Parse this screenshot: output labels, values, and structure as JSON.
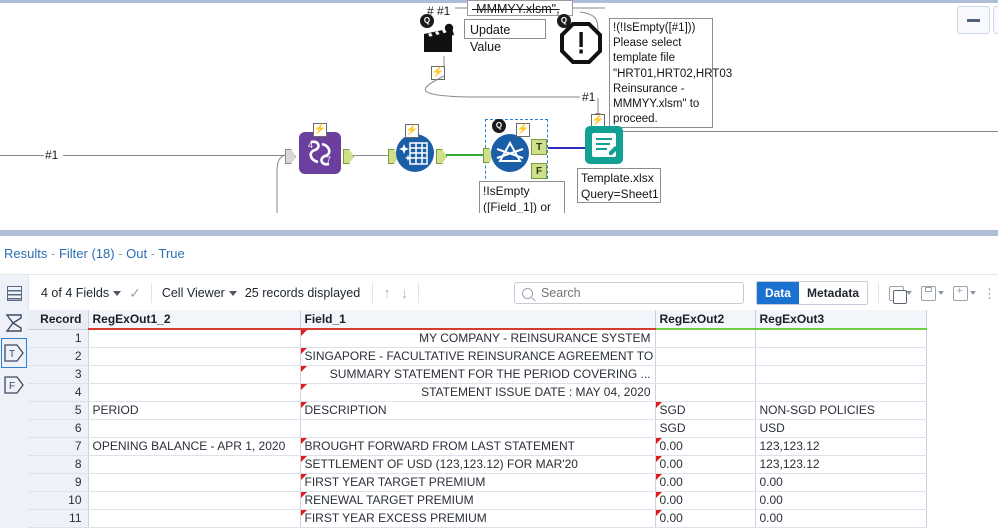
{
  "window": {
    "minimize_label": "minimize"
  },
  "canvas": {
    "annotations": [
      {
        "name": "update-value-box",
        "text": "Update Value"
      },
      {
        "name": "strikethrough-filename-note",
        "text": "-MMMYY.xlsm\","
      },
      {
        "name": "message-box",
        "text": "!(!IsEmpty([#1])) Please select template file \"HRT01,HRT02,HRT03 Reinsurance -MMMYY.xlsm\" to proceed."
      },
      {
        "name": "filter-expression-note",
        "text": "!IsEmpty ([Field_1]) or"
      },
      {
        "name": "output-file-note",
        "text": "Template.xlsx Query=Sheet1"
      }
    ],
    "connection_labels": [
      "# #1",
      "#1",
      "#1",
      "#1"
    ],
    "node_labels": {
      "true_port": "T",
      "false_port": "F"
    },
    "colors": {
      "purple_tool": "#6c3f9e",
      "blue_tool": "#1b5ea8",
      "teal_tool": "#12a095",
      "green_wire": "#2bab3a",
      "blue_wire": "#2d2dbb"
    }
  },
  "results": {
    "title_parts": [
      "Results",
      "-",
      "Filter (18)",
      "-",
      "Out",
      "-",
      "True"
    ],
    "toolbar": {
      "fields_label": "4 of 4 Fields",
      "viewer_label": "Cell Viewer",
      "records_label": "25 records displayed",
      "search_placeholder": "Search",
      "search_value": "",
      "data_tab": "Data",
      "metadata_tab": "Metadata",
      "active_tab": "Data",
      "icons": [
        "grip-icon",
        "check-icon",
        "arrow-up-icon",
        "arrow-down-icon",
        "search-icon",
        "copy-icon",
        "save-icon",
        "add-icon",
        "more-icon"
      ]
    },
    "side_buttons": [
      "sigma-icon",
      "true-filter-icon",
      "false-filter-icon"
    ],
    "active_side_button": "true-filter-icon",
    "table": {
      "columns": [
        {
          "label": "Record",
          "type": "record"
        },
        {
          "label": "RegExOut1_2",
          "type": "string"
        },
        {
          "label": "Field_1",
          "type": "string"
        },
        {
          "label": "RegExOut2",
          "type": "numeric"
        },
        {
          "label": "RegExOut3",
          "type": "numeric"
        }
      ],
      "rows": [
        {
          "record": "1",
          "regexout1_2": "",
          "field_1": "MY COMPANY - REINSURANCE SYSTEM",
          "field_1_align": "right",
          "regexout2": "",
          "regexout3": "",
          "marks": {
            "field_1": true
          }
        },
        {
          "record": "2",
          "regexout1_2": "",
          "field_1": "SINGAPORE  - FACULTATIVE REINSURANCE AGREEMENT TO THE...",
          "field_1_align": "right",
          "regexout2": "",
          "regexout3": "",
          "marks": {
            "field_1": true
          }
        },
        {
          "record": "3",
          "regexout1_2": "",
          "field_1": "SUMMARY STATEMENT FOR THE PERIOD COVERING ...",
          "field_1_align": "right",
          "regexout2": "",
          "regexout3": "",
          "marks": {
            "field_1": true
          }
        },
        {
          "record": "4",
          "regexout1_2": "",
          "field_1": "STATEMENT ISSUE DATE : MAY 04, 2020",
          "field_1_align": "right",
          "regexout2": "",
          "regexout3": "",
          "marks": {
            "field_1": true
          }
        },
        {
          "record": "5",
          "regexout1_2": "PERIOD",
          "field_1": "DESCRIPTION",
          "field_1_align": "left",
          "regexout2": "SGD",
          "regexout3": "NON-SGD POLICIES",
          "marks": {
            "field_1": true,
            "regexout2": true
          }
        },
        {
          "record": "6",
          "regexout1_2": "",
          "field_1": "",
          "field_1_align": "left",
          "regexout2": "SGD",
          "regexout3": "USD",
          "marks": {}
        },
        {
          "record": "7",
          "regexout1_2": "OPENING BALANCE - APR 1, 2020",
          "field_1": "BROUGHT FORWARD FROM LAST STATEMENT",
          "field_1_align": "left",
          "regexout2": "0.00",
          "regexout3": "123,123.12",
          "marks": {
            "field_1": true,
            "regexout2": true
          }
        },
        {
          "record": "8",
          "regexout1_2": "",
          "field_1": "SETTLEMENT OF USD (123,123.12) FOR MAR'20",
          "field_1_align": "left",
          "regexout2": "0.00",
          "regexout3": "123,123.12",
          "marks": {
            "field_1": true,
            "regexout2": true
          }
        },
        {
          "record": "9",
          "regexout1_2": "",
          "field_1": "FIRST YEAR TARGET PREMIUM",
          "field_1_align": "left",
          "regexout2": "0.00",
          "regexout3": "0.00",
          "marks": {
            "field_1": true,
            "regexout2": true
          }
        },
        {
          "record": "10",
          "regexout1_2": "",
          "field_1": "RENEWAL TARGET PREMIUM",
          "field_1_align": "left",
          "regexout2": "0.00",
          "regexout3": "0.00",
          "marks": {
            "field_1": true,
            "regexout2": true
          }
        },
        {
          "record": "11",
          "regexout1_2": "",
          "field_1": "FIRST YEAR EXCESS PREMIUM",
          "field_1_align": "left",
          "regexout2": "0.00",
          "regexout3": "0.00",
          "marks": {
            "field_1": true,
            "regexout2": true
          }
        }
      ]
    }
  }
}
